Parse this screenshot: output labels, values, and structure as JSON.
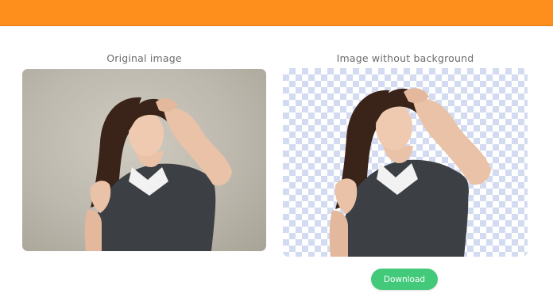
{
  "header": {
    "color": "#ff8f1c"
  },
  "original": {
    "caption": "Original image"
  },
  "result": {
    "caption": "Image without background"
  },
  "actions": {
    "download_label": "Download",
    "download_color": "#42c97a"
  }
}
